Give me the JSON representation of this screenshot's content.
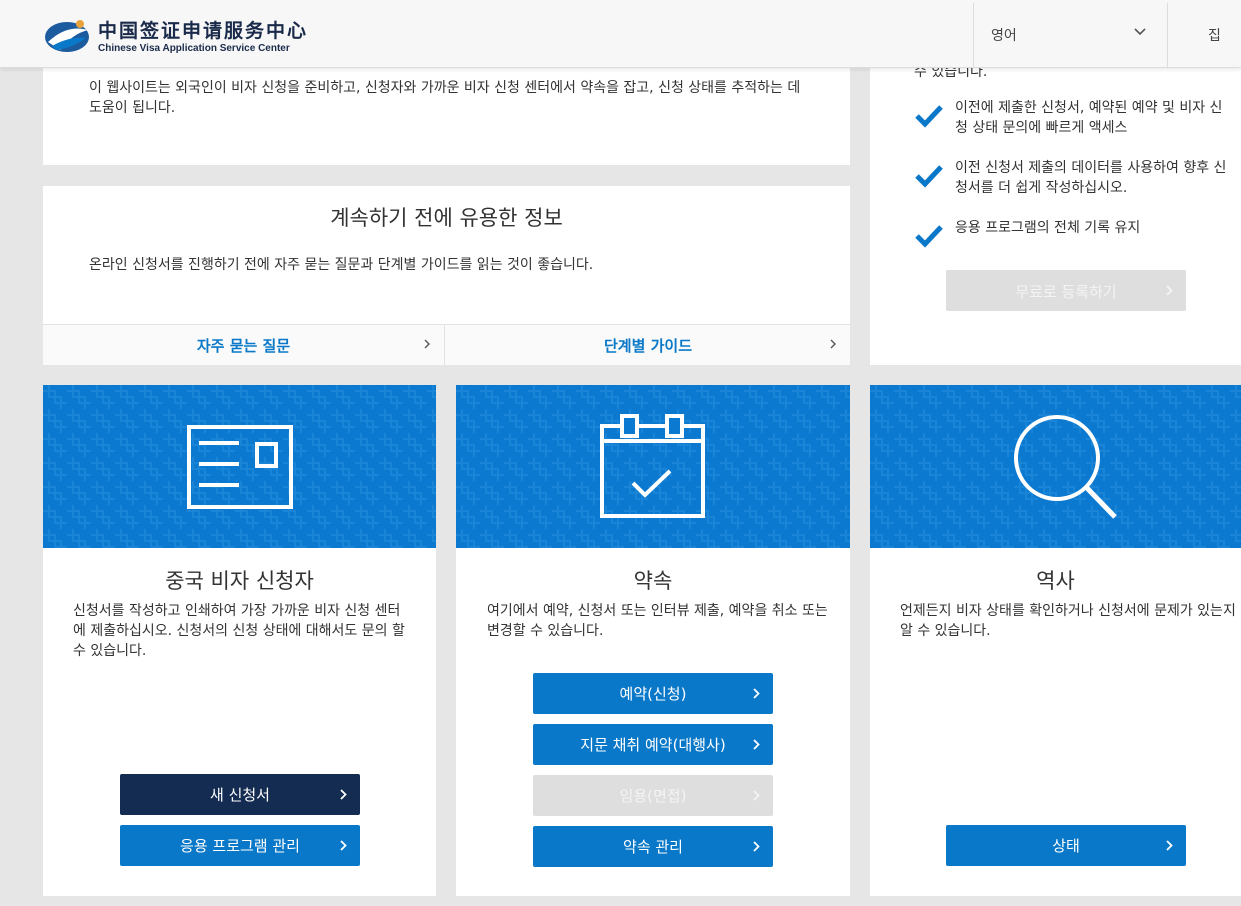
{
  "header": {
    "logo_cn": "中国签证申请服务中心",
    "logo_en": "Chinese Visa Application Service Center",
    "language": "영어",
    "home": "집"
  },
  "intro": {
    "text": "이 웹사이트는 외국인이 비자 신청을 준비하고, 신청자와 가까운 비자 신청 센터에서 약속을 잡고, 신청 상태를 추적하는 데 도움이 됩니다."
  },
  "info": {
    "title": "계속하기 전에 유용한 정보",
    "text": "온라인 신청서를 진행하기 전에 자주 묻는 질문과 단계별 가이드를 읽는 것이 좋습니다.",
    "faq_label": "자주 묻는 질문",
    "guide_label": "단계별 가이드"
  },
  "register": {
    "top_text": "수 있습니다.",
    "benefits": [
      "이전에 제출한 신청서, 예약된 예약 및 비자 신청 상태 문의에 빠르게 액세스",
      "이전 신청서 제출의 데이터를 사용하여 향후 신청서를 더 쉽게 작성하십시오.",
      "응용 프로그램의 전체 기록 유지"
    ],
    "button_label": "무료로 등록하기"
  },
  "applicant": {
    "title": "중국 비자 신청자",
    "desc": "신청서를 작성하고 인쇄하여 가장 가까운 비자 신청 센터에 제출하십시오. 신청서의 신청 상태에 대해서도 문의 할 수 있습니다.",
    "new_label": "새 신청서",
    "manage_label": "응용 프로그램 관리"
  },
  "appointment": {
    "title": "약속",
    "desc": "여기에서 예약, 신청서 또는 인터뷰 제출, 예약을 취소 또는 변경할 수 있습니다.",
    "book_label": "예약(신청)",
    "fingerprint_label": "지문 채취 예약(대행사)",
    "interview_label": "임용(면접)",
    "manage_label": "약속 관리"
  },
  "history": {
    "title": "역사",
    "desc": "언제든지 비자 상태를 확인하거나 신청서에 문제가 있는지 알 수 있습니다.",
    "status_label": "상태"
  },
  "colors": {
    "primary_blue": "#0a78c8",
    "banner_blue": "#0b79cf",
    "navy": "#142c52",
    "disabled_gray": "#dedede"
  }
}
